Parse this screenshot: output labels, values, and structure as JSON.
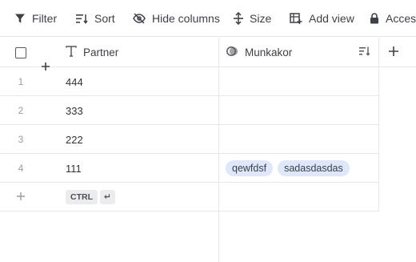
{
  "toolbar": {
    "filter_label": "Filter",
    "sort_label": "Sort",
    "hide_columns_label": "Hide columns",
    "size_label": "Size",
    "add_view_label": "Add view",
    "access_label": "Access"
  },
  "columns": {
    "partner": "Partner",
    "munkakor": "Munkakor"
  },
  "rows": [
    {
      "num": "1",
      "partner": "444",
      "tags": []
    },
    {
      "num": "2",
      "partner": "333",
      "tags": []
    },
    {
      "num": "3",
      "partner": "222",
      "tags": []
    },
    {
      "num": "4",
      "partner": "111",
      "tags": [
        "qewfdsf",
        "sadasdasdas"
      ]
    }
  ],
  "new_row": {
    "ctrl_label": "CTRL",
    "enter_glyph": "↵"
  },
  "colors": {
    "tag_bg": "#dfe7fb",
    "border": "#e6e7ea",
    "text": "#2f3237"
  },
  "icons": [
    "filter-icon",
    "sort-icon",
    "hide-icon",
    "size-icon",
    "add-view-icon",
    "lock-icon",
    "text-type-icon",
    "select-type-icon",
    "sort-column-icon",
    "plus-icon"
  ]
}
